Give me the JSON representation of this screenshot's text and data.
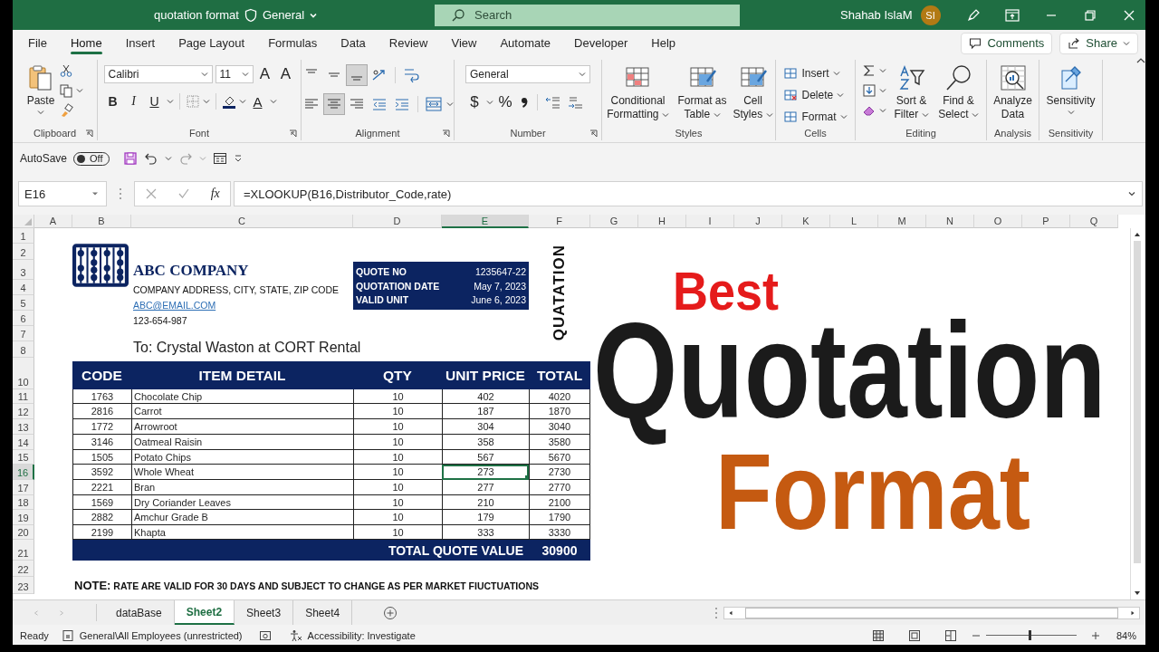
{
  "title_bar": {
    "document": "quotation format",
    "sensitivity": "General",
    "search_placeholder": "Search",
    "user": "Shahab IslaM",
    "initials": "SI"
  },
  "ribbon_tabs": [
    {
      "label": "File",
      "selected": false
    },
    {
      "label": "Home",
      "selected": true
    },
    {
      "label": "Insert",
      "selected": false
    },
    {
      "label": "Page Layout",
      "selected": false
    },
    {
      "label": "Formulas",
      "selected": false
    },
    {
      "label": "Data",
      "selected": false
    },
    {
      "label": "Review",
      "selected": false
    },
    {
      "label": "View",
      "selected": false
    },
    {
      "label": "Automate",
      "selected": false
    },
    {
      "label": "Developer",
      "selected": false
    },
    {
      "label": "Help",
      "selected": false
    }
  ],
  "ribbon_actions": {
    "comments": "Comments",
    "share": "Share"
  },
  "ribbon_groups": [
    {
      "kind": "clipboard",
      "label": "Clipboard",
      "paste": "Paste"
    },
    {
      "kind": "font",
      "label": "Font",
      "font_name": "Calibri",
      "font_size": "11",
      "size_glyphs": [
        "A",
        "A"
      ],
      "style_buttons": [
        "B",
        "I",
        "U"
      ],
      "font_color_glyph": "A"
    },
    {
      "kind": "alignment",
      "label": "Alignment",
      "vertical": [
        {
          "selected": false
        },
        {
          "selected": false
        },
        {
          "selected": true
        }
      ],
      "horizontal": [
        {
          "selected": false
        },
        {
          "selected": true
        },
        {
          "selected": false
        }
      ]
    },
    {
      "kind": "number",
      "label": "Number",
      "format": "General",
      "currency": "$",
      "percent": "%"
    },
    {
      "kind": "styles",
      "label": "Styles",
      "buttons": [
        "Conditional Formatting",
        "Format as Table",
        "Cell Styles"
      ]
    },
    {
      "kind": "cells",
      "label": "Cells",
      "buttons": [
        "Insert",
        "Delete",
        "Format"
      ]
    },
    {
      "kind": "editing",
      "label": "Editing",
      "buttons": [
        "Sort & Filter",
        "Find & Select"
      ]
    },
    {
      "kind": "analysis",
      "label": "Analysis",
      "buttons": [
        "Analyze Data"
      ]
    },
    {
      "kind": "sensitivity",
      "label": "Sensitivity",
      "buttons": [
        "Sensitivity"
      ]
    }
  ],
  "quick_access": {
    "autosave": "AutoSave",
    "autosave_on": false,
    "toggle_text": "Off"
  },
  "formula_bar": {
    "name_box": "E16",
    "function_glyph": "fx",
    "formula": "=XLOOKUP(B16,Distributor_Code,rate)"
  },
  "columns": [
    {
      "label": "A",
      "selected": false
    },
    {
      "label": "B",
      "selected": false
    },
    {
      "label": "C",
      "selected": false
    },
    {
      "label": "D",
      "selected": false
    },
    {
      "label": "E",
      "selected": true
    },
    {
      "label": "F",
      "selected": false
    },
    {
      "label": "G",
      "selected": false
    },
    {
      "label": "H",
      "selected": false
    },
    {
      "label": "I",
      "selected": false
    },
    {
      "label": "J",
      "selected": false
    },
    {
      "label": "K",
      "selected": false
    },
    {
      "label": "L",
      "selected": false
    },
    {
      "label": "M",
      "selected": false
    },
    {
      "label": "N",
      "selected": false
    },
    {
      "label": "O",
      "selected": false
    },
    {
      "label": "P",
      "selected": false
    },
    {
      "label": "Q",
      "selected": false
    }
  ],
  "rows": [
    {
      "label": "1",
      "selected": false
    },
    {
      "label": "2",
      "selected": false
    },
    {
      "label": "3",
      "selected": false
    },
    {
      "label": "4",
      "selected": false
    },
    {
      "label": "5",
      "selected": false
    },
    {
      "label": "6",
      "selected": false
    },
    {
      "label": "7",
      "selected": false
    },
    {
      "label": "8",
      "selected": false
    },
    {
      "label": "10",
      "selected": false
    },
    {
      "label": "11",
      "selected": false
    },
    {
      "label": "12",
      "selected": false
    },
    {
      "label": "13",
      "selected": false
    },
    {
      "label": "14",
      "selected": false
    },
    {
      "label": "15",
      "selected": false
    },
    {
      "label": "16",
      "selected": true
    },
    {
      "label": "17",
      "selected": false
    },
    {
      "label": "18",
      "selected": false
    },
    {
      "label": "19",
      "selected": false
    },
    {
      "label": "20",
      "selected": false
    },
    {
      "label": "21",
      "selected": false
    },
    {
      "label": "22",
      "selected": false
    },
    {
      "label": "23",
      "selected": false
    }
  ],
  "quotation": {
    "company": "ABC COMPANY",
    "address": "COMPANY ADDRESS, CITY, STATE, ZIP CODE",
    "email": "ABC@EMAIL.COM",
    "phone": "123-654-987",
    "recipient": "To: Crystal Waston at CORT Rental",
    "details": [
      {
        "label": "QUOTE NO",
        "value": "1235647-22"
      },
      {
        "label": "QUOTATION DATE",
        "value": "May 7, 2023"
      },
      {
        "label": "VALID UNIT",
        "value": "June 6, 2023"
      }
    ],
    "vertical_title": "QUATATION",
    "headers": [
      "CODE",
      "ITEM DETAIL",
      "QTY",
      "UNIT PRICE",
      "TOTAL"
    ],
    "items": [
      {
        "code": "1763",
        "item": "Chocolate Chip",
        "qty": "10",
        "unit_price": "402",
        "total": "4020",
        "selected": false
      },
      {
        "code": "2816",
        "item": "Carrot",
        "qty": "10",
        "unit_price": "187",
        "total": "1870",
        "selected": false
      },
      {
        "code": "1772",
        "item": "Arrowroot",
        "qty": "10",
        "unit_price": "304",
        "total": "3040",
        "selected": false
      },
      {
        "code": "3146",
        "item": "Oatmeal Raisin",
        "qty": "10",
        "unit_price": "358",
        "total": "3580",
        "selected": false
      },
      {
        "code": "1505",
        "item": "Potato Chips",
        "qty": "10",
        "unit_price": "567",
        "total": "5670",
        "selected": false
      },
      {
        "code": "3592",
        "item": "Whole Wheat",
        "qty": "10",
        "unit_price": "273",
        "total": "2730",
        "selected": true
      },
      {
        "code": "2221",
        "item": "Bran",
        "qty": "10",
        "unit_price": "277",
        "total": "2770",
        "selected": false
      },
      {
        "code": "1569",
        "item": "Dry Coriander Leaves",
        "qty": "10",
        "unit_price": "210",
        "total": "2100",
        "selected": false
      },
      {
        "code": "2882",
        "item": "Amchur Grade B",
        "qty": "10",
        "unit_price": "179",
        "total": "1790",
        "selected": false
      },
      {
        "code": "2199",
        "item": "Khapta",
        "qty": "10",
        "unit_price": "333",
        "total": "3330",
        "selected": false
      }
    ],
    "total_label": "TOTAL QUOTE VALUE",
    "total_value": "30900",
    "note_label": "NOTE:",
    "note_text": "RATE ARE VALID FOR 30 DAYS AND SUBJECT TO CHANGE AS PER MARKET FIUCTUATIONS"
  },
  "overlay": {
    "line_1": "Best",
    "line_2": "Quotation",
    "line_3": "Format"
  },
  "sheet_tabs": [
    {
      "label": "dataBase",
      "selected": false
    },
    {
      "label": "Sheet2",
      "selected": true
    },
    {
      "label": "Sheet3",
      "selected": false
    },
    {
      "label": "Sheet4",
      "selected": false
    }
  ],
  "status_bar": {
    "ready": "Ready",
    "sensitivity": "General\\All Employees (unrestricted)",
    "accessibility": "Accessibility: Investigate",
    "zoom": "84%",
    "zoom_slider": {
      "level": 0.48
    }
  }
}
